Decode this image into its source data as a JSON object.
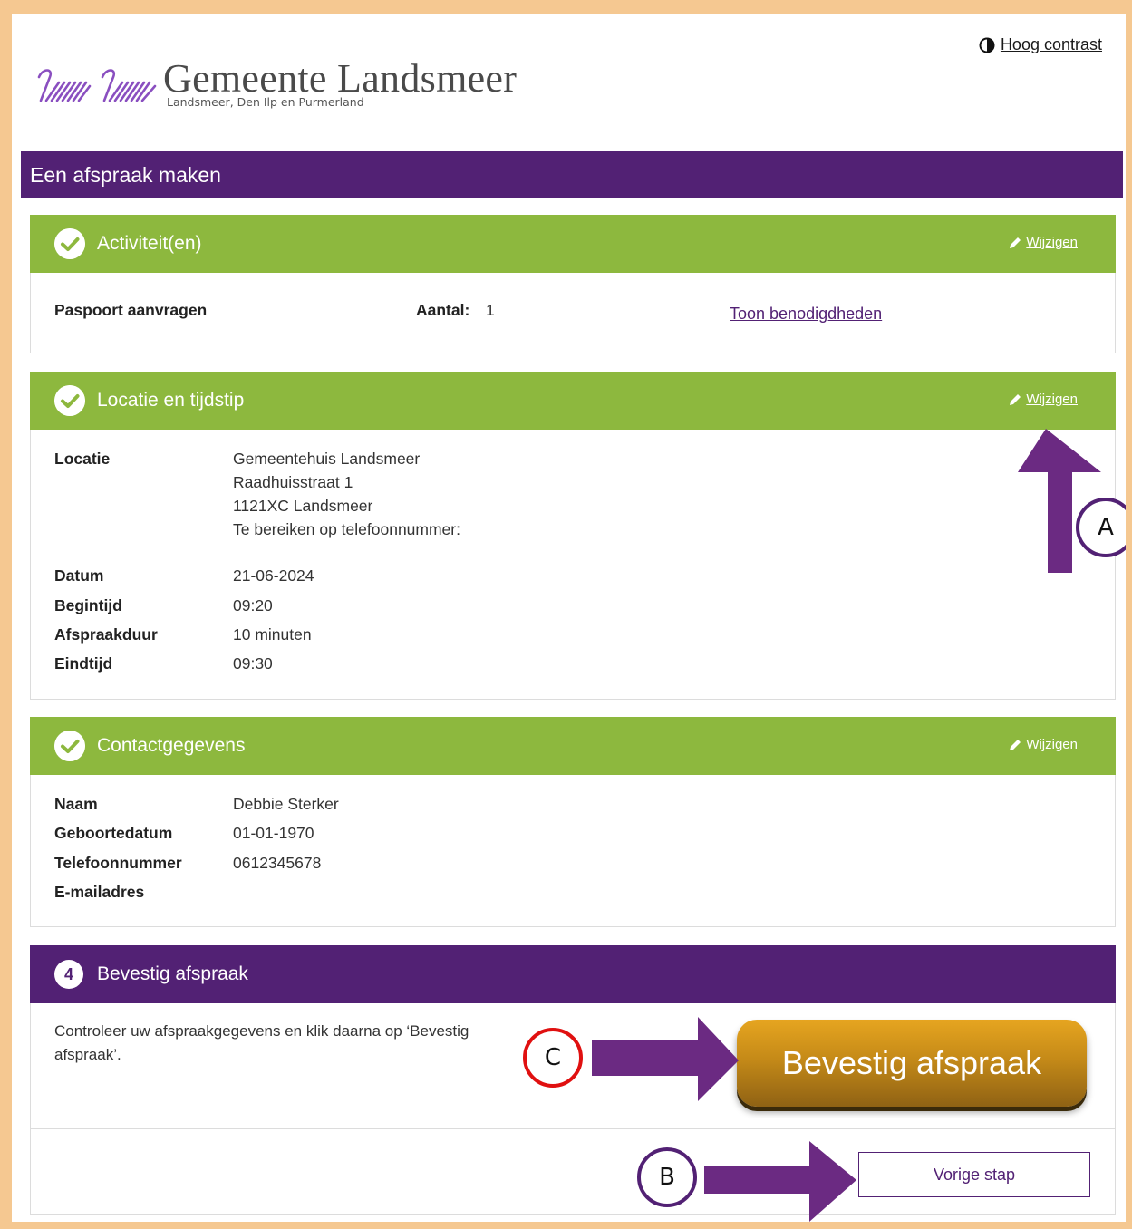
{
  "header": {
    "brand_title": "Gemeente Landsmeer",
    "brand_subtitle": "Landsmeer, Den Ilp en Purmerland",
    "contrast_label": "Hoog contrast",
    "banner_title": "Een afspraak maken"
  },
  "colors": {
    "purple": "#522174",
    "green": "#8db83e",
    "button_gold": "#c58a18"
  },
  "activities": {
    "title": "Activiteit(en)",
    "edit_label": "Wijzigen",
    "item": "Paspoort aanvragen",
    "count_label": "Aantal:",
    "count_value": "1",
    "requirements_link": "Toon benodigdheden"
  },
  "location": {
    "title": "Locatie en tijdstip",
    "edit_label": "Wijzigen",
    "location_label": "Locatie",
    "address": [
      "Gemeentehuis Landsmeer",
      "Raadhuisstraat 1",
      "1121XC Landsmeer",
      "Te bereiken op telefoonnummer:"
    ],
    "rows": [
      {
        "label": "Datum",
        "value": "21-06-2024"
      },
      {
        "label": "Begintijd",
        "value": "09:20"
      },
      {
        "label": "Afspraakduur",
        "value": "10 minuten"
      },
      {
        "label": "Eindtijd",
        "value": "09:30"
      }
    ]
  },
  "contact": {
    "title": "Contactgegevens",
    "edit_label": "Wijzigen",
    "rows": [
      {
        "label": "Naam",
        "value": "Debbie Sterker"
      },
      {
        "label": "Geboortedatum",
        "value": "01-01-1970"
      },
      {
        "label": "Telefoonnummer",
        "value": "0612345678"
      },
      {
        "label": "E-mailadres",
        "value": ""
      }
    ]
  },
  "confirm": {
    "step_number": "4",
    "title": "Bevestig afspraak",
    "instruction": [
      "Controleer uw afspraakgegevens en klik daarna op ‘Bevestig",
      "afspraak’."
    ],
    "button_label": "Bevestig afspraak",
    "previous_label": "Vorige stap"
  },
  "annotations": {
    "a": "A",
    "b": "B",
    "c": "C"
  },
  "icons": [
    "logo-swans-icon",
    "contrast-icon",
    "pencil-icon",
    "checkmark-icon"
  ]
}
